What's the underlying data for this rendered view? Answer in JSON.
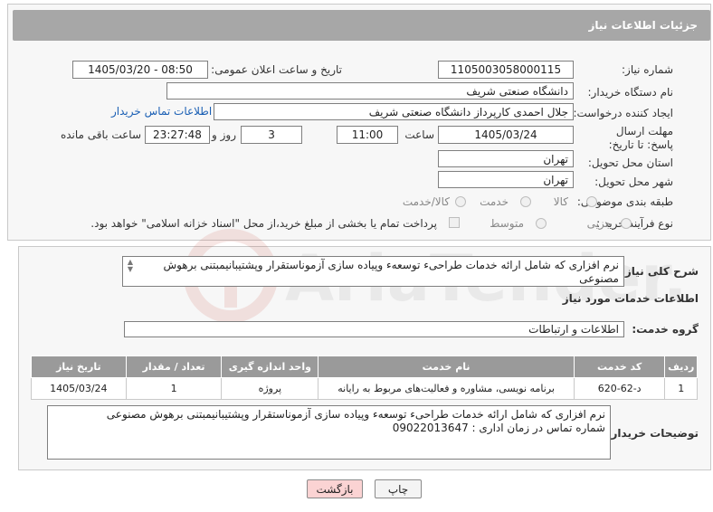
{
  "header": {
    "title": "جزئیات اطلاعات نیاز"
  },
  "form": {
    "need_number_label": "شماره نیاز:",
    "need_number": "1105003058000115",
    "announce_label": "تاریخ و ساعت اعلان عمومی:",
    "announce_value": "1405/03/20 - 08:50",
    "buyer_org_label": "نام دستگاه خریدار:",
    "buyer_org": "دانشگاه صنعتی شریف",
    "creator_label": "ایجاد کننده درخواست:",
    "creator": "جلال احمدی کارپرداز دانشگاه صنعتی شریف",
    "contact_link": "اطلاعات تماس خریدار",
    "deadline_label": "مهلت ارسال پاسخ: تا تاریخ:",
    "deadline_date": "1405/03/24",
    "time_label": "ساعت",
    "deadline_time": "11:00",
    "days_value": "3",
    "days_label": "روز و",
    "remaining_time": "23:27:48",
    "remaining_label": "ساعت باقی مانده",
    "province_label": "استان محل تحویل:",
    "province": "تهران",
    "city_label": "شهر محل تحویل:",
    "city": "تهران",
    "category_label": "طبقه بندی موضوعی:",
    "category_options": [
      "کالا",
      "خدمت",
      "کالا/خدمت"
    ],
    "process_label": "نوع فرآیند خرید :",
    "process_options": [
      "جزیی",
      "متوسط"
    ],
    "payment_note": "پرداخت تمام یا بخشی از مبلغ خرید،از محل \"اسناد خزانه اسلامی\" خواهد بود."
  },
  "summary": {
    "label": "شرح کلی نیاز:",
    "text": "نرم افزاری که شامل ارائه خدمات طراحیء توسعهء وپیاده سازی آزموناستقرار وپشتیبانیمبتنی برهوش مصنوعی"
  },
  "services": {
    "section_title": "اطلاعات خدمات مورد نیاز",
    "group_label": "گروه خدمت:",
    "group_value": "اطلاعات و ارتباطات",
    "columns": [
      "ردیف",
      "کد خدمت",
      "نام خدمت",
      "واحد اندازه گیری",
      "تعداد / مقدار",
      "تاریخ نیاز"
    ],
    "rows": [
      [
        "1",
        "د-62-620",
        "برنامه نویسی، مشاوره و فعالیت‌های مربوط به رایانه",
        "پروژه",
        "1",
        "1405/03/24"
      ]
    ]
  },
  "buyer_notes": {
    "label": "توضیحات خریدار:",
    "text": "نرم افزاری که شامل ارائه خدمات طراحیء توسعهء وپیاده سازی آزموناستقرار وپشتیبانیمبتنی برهوش مصنوعی\nشماره تماس در زمان اداری : 09022013647"
  },
  "buttons": {
    "print": "چاپ",
    "back": "بازگشت"
  },
  "watermark": {
    "text": "AriaTender.neT"
  }
}
